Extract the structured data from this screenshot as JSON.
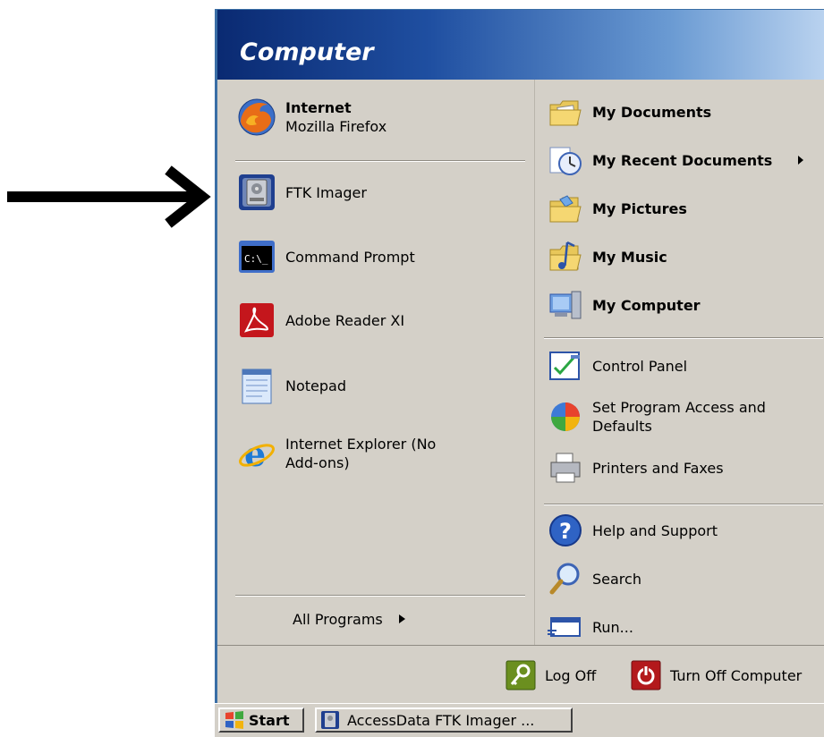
{
  "header": {
    "title": "Computer"
  },
  "left_column": {
    "pinned": {
      "title": "Internet",
      "subtitle": "Mozilla Firefox",
      "icon": "firefox-icon"
    },
    "recent": [
      {
        "label": "FTK Imager",
        "icon": "ftk-imager-icon"
      },
      {
        "label": "Command Prompt",
        "icon": "command-prompt-icon"
      },
      {
        "label": "Adobe Reader XI",
        "icon": "adobe-reader-icon"
      },
      {
        "label": "Notepad",
        "icon": "notepad-icon"
      },
      {
        "label_line1": "Internet Explorer (No",
        "label_line2": "Add-ons)",
        "icon": "internet-explorer-icon"
      }
    ],
    "all_programs": "All Programs"
  },
  "right_column": {
    "places": [
      {
        "label": "My Documents",
        "icon": "folder-documents-icon"
      },
      {
        "label": "My Recent Documents",
        "icon": "recent-documents-icon"
      },
      {
        "label": "My Pictures",
        "icon": "folder-pictures-icon"
      },
      {
        "label": "My Music",
        "icon": "folder-music-icon"
      },
      {
        "label": "My Computer",
        "icon": "my-computer-icon"
      }
    ],
    "settings": [
      {
        "label": "Control Panel",
        "icon": "control-panel-icon"
      },
      {
        "label_line1": "Set Program Access and",
        "label_line2": "Defaults",
        "icon": "program-access-icon"
      },
      {
        "label": "Printers and Faxes",
        "icon": "printer-icon"
      }
    ],
    "help": [
      {
        "label": "Help and Support",
        "icon": "help-icon"
      },
      {
        "label": "Search",
        "icon": "search-icon"
      },
      {
        "label": "Run...",
        "icon": "run-icon"
      }
    ]
  },
  "footer": {
    "log_off": "Log Off",
    "turn_off": "Turn Off Computer"
  },
  "taskbar": {
    "start": "Start",
    "task": "AccessData FTK Imager ..."
  },
  "colors": {
    "header_dark": "#0a2a72",
    "header_light": "#b9d2ef",
    "menu_bg": "#d4d0c8",
    "accent_border": "#3a6ea5"
  }
}
